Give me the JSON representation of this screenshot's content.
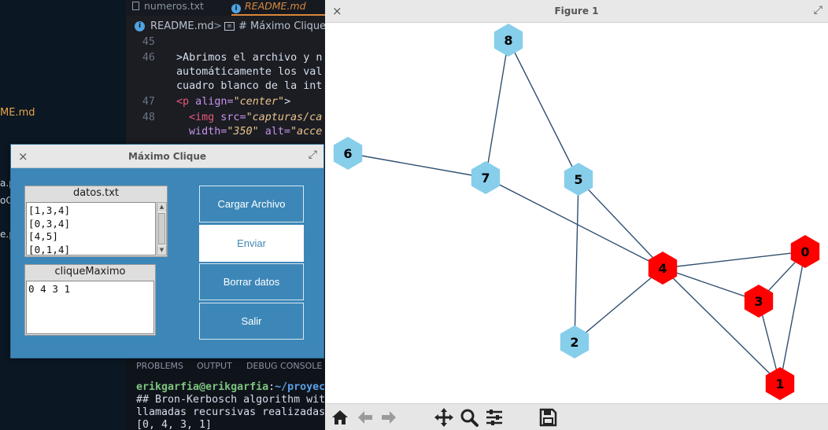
{
  "vscode": {
    "sidebar": {
      "file_fragment": "ME.md",
      "fragments": [
        "a.p",
        "oC",
        "e.p"
      ]
    },
    "tabs": [
      {
        "label": "numeros.txt",
        "active": false
      },
      {
        "label": "README.md",
        "active": true
      }
    ],
    "breadcrumb": {
      "file": "README.md",
      "separator": ">",
      "section": "# Máximo Clique"
    },
    "code_lines": [
      {
        "num": "45",
        "text": ""
      },
      {
        "num": "46",
        "text": ">Abrimos el archivo y n"
      },
      {
        "num": "",
        "text": "automáticamente los val"
      },
      {
        "num": "",
        "text": "cuadro blanco de la int"
      },
      {
        "num": "47",
        "tag": "<p",
        "attr": " align=",
        "str": "\"center\"",
        "end": ">"
      },
      {
        "num": "48",
        "tag": "<img",
        "attr": " src=",
        "str": "\"capturas/ca"
      },
      {
        "num": "",
        "attr": "width=",
        "str": "\"350\"",
        "attr2": " alt=",
        "str2": "\"acce"
      }
    ],
    "panel_tabs": [
      "PROBLEMS",
      "OUTPUT",
      "DEBUG CONSOLE"
    ],
    "terminal": {
      "user": "erikgarfia@erikgarfia",
      "colon": ":",
      "path": "~/proyec",
      "lines": [
        "## Bron-Kerbosch algorithm wit",
        "llamadas recursivas realizadas",
        "[0, 4, 3, 1]"
      ]
    }
  },
  "clique_window": {
    "title": "Máximo Clique",
    "close_glyph": "×",
    "maximize_glyph": "⤢",
    "datos": {
      "label": "datos.txt",
      "content": "[1,3,4]\n[0,3,4]\n[4,5]\n[0,1,4]"
    },
    "clique": {
      "label": "cliqueMaximo",
      "content": "0 4 3 1"
    },
    "buttons": {
      "load": "Cargar Archivo",
      "send": "Enviar",
      "clear": "Borrar datos",
      "exit": "Salir"
    }
  },
  "figure_window": {
    "title": "Figure 1",
    "close_glyph": "×",
    "maximize_glyph": "⤢",
    "graph": {
      "colors": {
        "default": "#87ceeb",
        "clique": "#ff0000",
        "edge": "#2f4f6f",
        "label": "#000000"
      },
      "nodes": [
        {
          "id": "0",
          "in_clique": true
        },
        {
          "id": "1",
          "in_clique": true
        },
        {
          "id": "2",
          "in_clique": false
        },
        {
          "id": "3",
          "in_clique": true
        },
        {
          "id": "4",
          "in_clique": true
        },
        {
          "id": "5",
          "in_clique": false
        },
        {
          "id": "6",
          "in_clique": false
        },
        {
          "id": "7",
          "in_clique": false
        },
        {
          "id": "8",
          "in_clique": false
        }
      ],
      "edges": [
        [
          "8",
          "7"
        ],
        [
          "8",
          "5"
        ],
        [
          "6",
          "7"
        ],
        [
          "7",
          "4"
        ],
        [
          "5",
          "4"
        ],
        [
          "5",
          "2"
        ],
        [
          "4",
          "2"
        ],
        [
          "4",
          "0"
        ],
        [
          "4",
          "3"
        ],
        [
          "4",
          "1"
        ],
        [
          "0",
          "3"
        ],
        [
          "0",
          "1"
        ],
        [
          "3",
          "1"
        ]
      ]
    },
    "toolbar_icons": [
      "home-icon",
      "back-arrow-icon",
      "forward-arrow-icon",
      "pan-icon",
      "zoom-icon",
      "configure-subplots-icon",
      "save-icon"
    ]
  }
}
